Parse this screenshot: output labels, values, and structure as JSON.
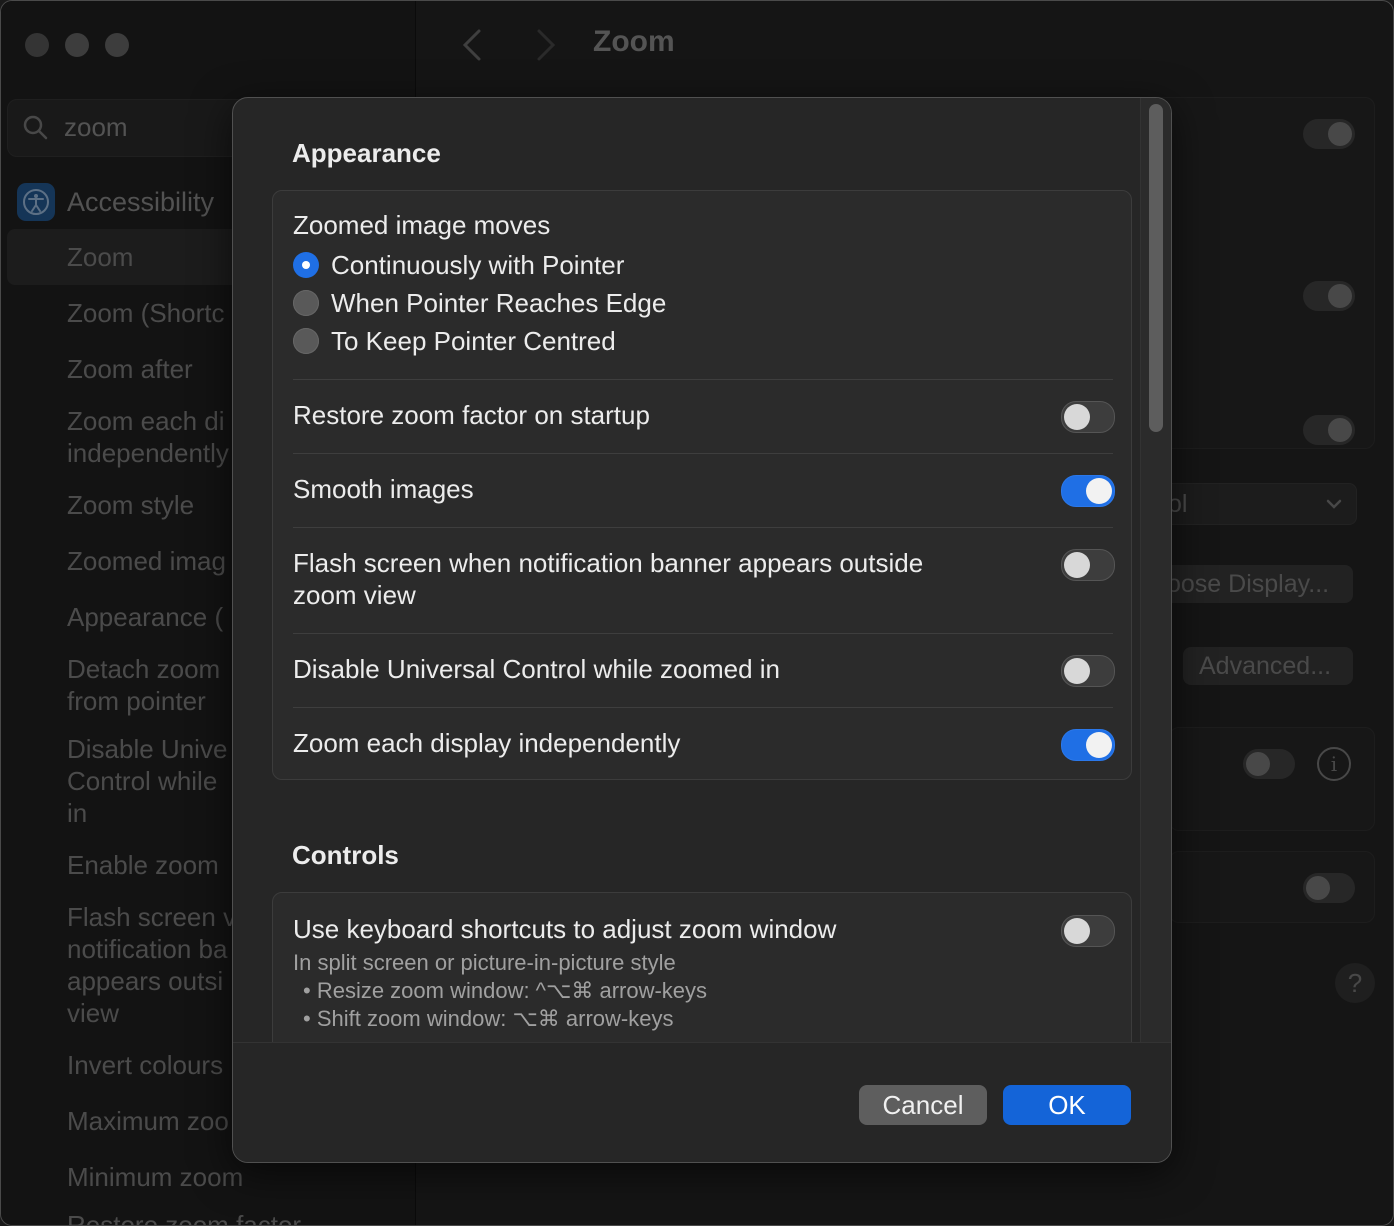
{
  "window": {
    "title": "Zoom"
  },
  "search": {
    "value": "zoom"
  },
  "sidebar": {
    "parent_label": "Accessibility",
    "items": [
      {
        "label": "Zoom"
      },
      {
        "label": "Zoom (Shortc"
      },
      {
        "label": "Zoom after"
      },
      {
        "label": "Zoom each di"
      },
      {
        "label": "independently"
      },
      {
        "label": "Zoom style"
      },
      {
        "label": "Zoomed imag"
      },
      {
        "label": "Appearance ("
      },
      {
        "label": "Detach zoom"
      },
      {
        "label": "from pointer"
      },
      {
        "label": "Disable Unive"
      },
      {
        "label": "Control while"
      },
      {
        "label": "in"
      },
      {
        "label": "Enable zoom"
      },
      {
        "label": "Flash screen v"
      },
      {
        "label": "notification ba"
      },
      {
        "label": "appears outsi"
      },
      {
        "label": "view"
      },
      {
        "label": "Invert colours"
      },
      {
        "label": "Maximum zoo"
      },
      {
        "label": "Minimum zoom"
      },
      {
        "label": "Restore zoom factor"
      }
    ]
  },
  "background": {
    "dropdown_fragment": "ol",
    "choose_display_label": "oose Display...",
    "advanced_label": "Advanced...",
    "help_label": "?",
    "info_label": "i"
  },
  "sheet": {
    "appearance": {
      "title": "Appearance",
      "zoomed_image_moves_label": "Zoomed image moves",
      "radio_options": [
        {
          "label": "Continuously with Pointer",
          "selected": true
        },
        {
          "label": "When Pointer Reaches Edge",
          "selected": false
        },
        {
          "label": "To Keep Pointer Centred",
          "selected": false
        }
      ],
      "restore_zoom": {
        "label": "Restore zoom factor on startup",
        "on": false
      },
      "smooth_images": {
        "label": "Smooth images",
        "on": true
      },
      "flash_screen": {
        "label_line1": "Flash screen when notification banner appears outside",
        "label_line2": "zoom view",
        "on": false
      },
      "disable_universal": {
        "label": "Disable Universal Control while zoomed in",
        "on": false
      },
      "zoom_each_display": {
        "label": "Zoom each display independently",
        "on": true
      }
    },
    "controls": {
      "title": "Controls",
      "keyboard_shortcuts": {
        "label": "Use keyboard shortcuts to adjust zoom window",
        "on": false,
        "description": "In split screen or picture-in-picture style",
        "bullets": [
          "• Resize zoom window: ^⌥⌘ arrow-keys",
          "• Shift zoom window: ⌥⌘ arrow-keys"
        ]
      }
    },
    "buttons": {
      "cancel": "Cancel",
      "ok": "OK"
    }
  }
}
